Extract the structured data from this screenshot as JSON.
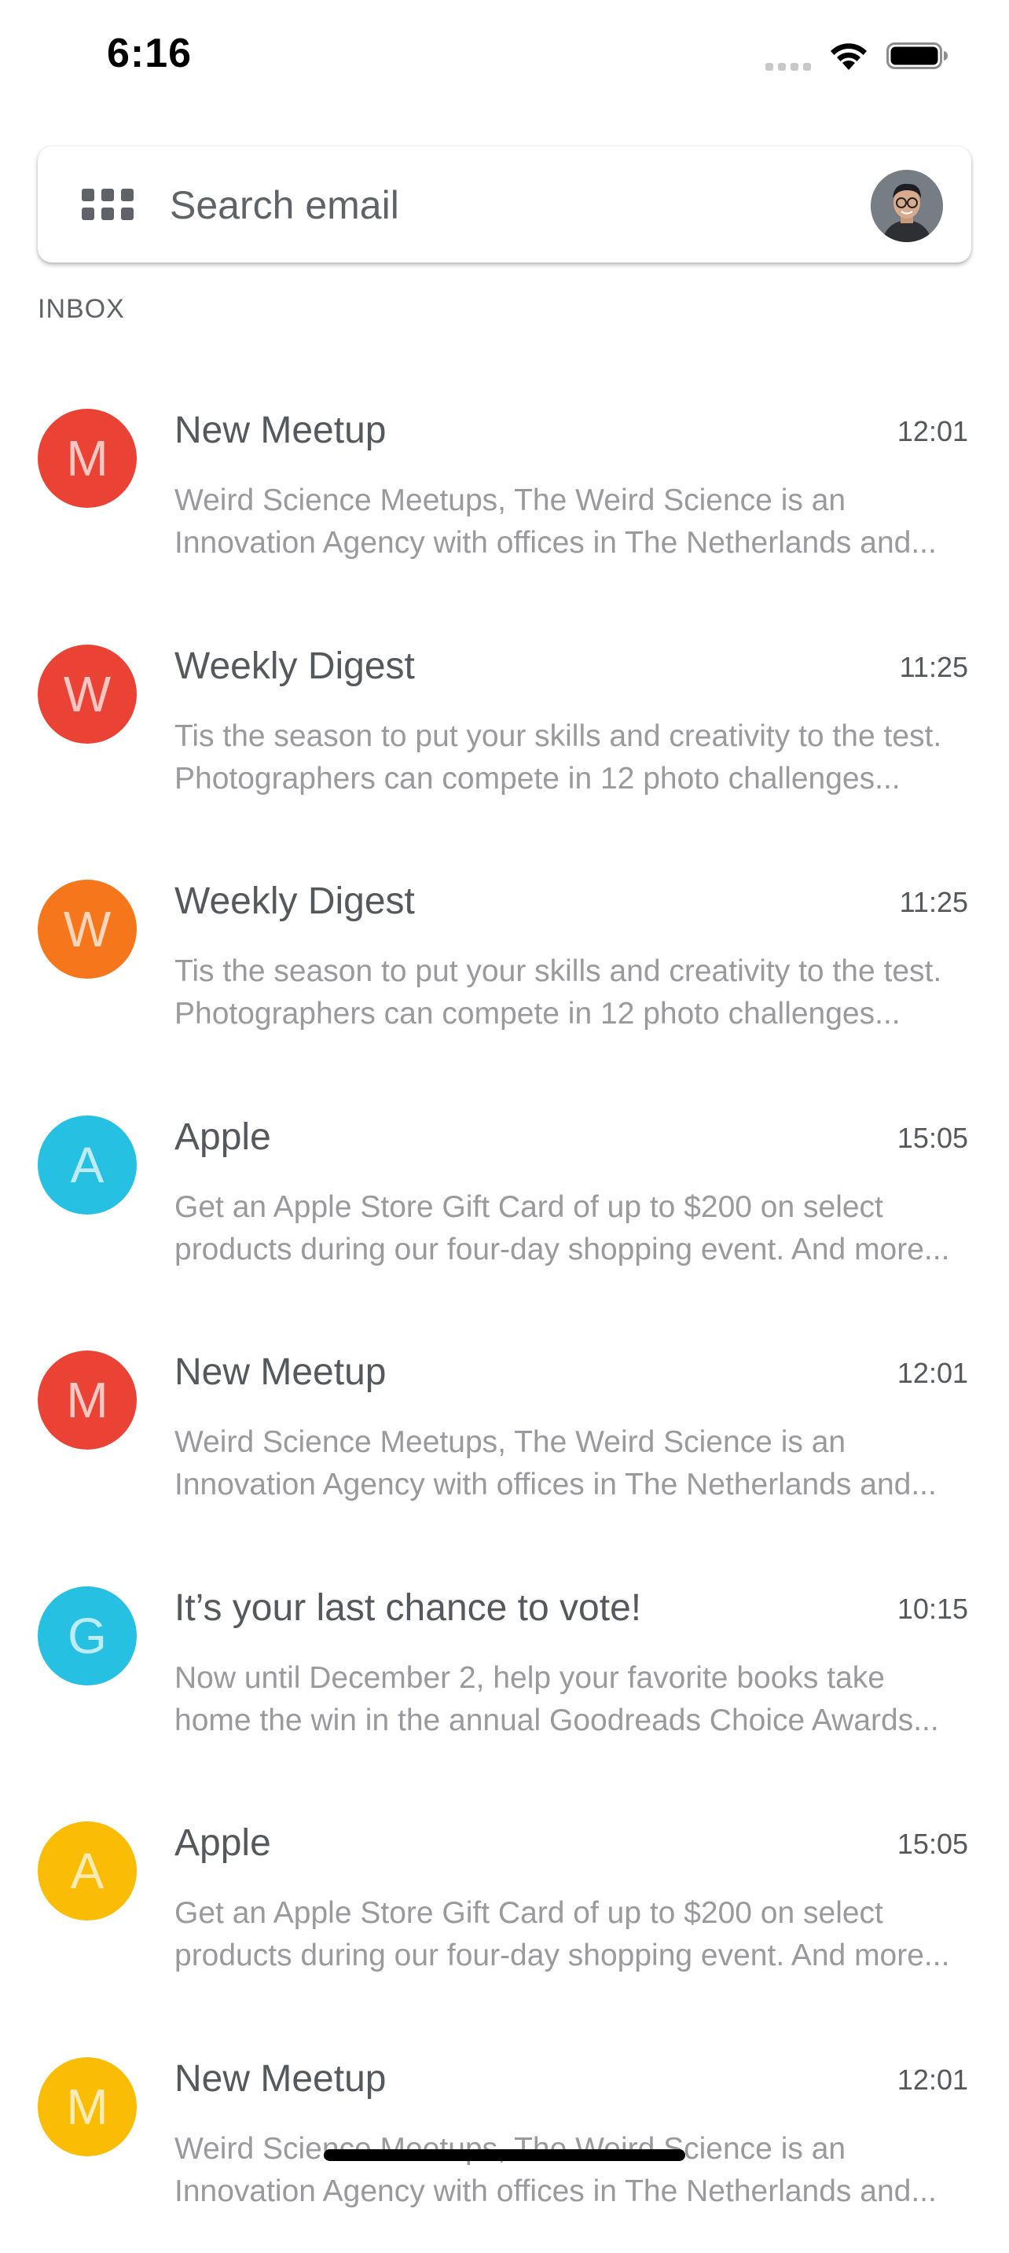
{
  "status_bar": {
    "time": "6:16"
  },
  "search": {
    "placeholder": "Search email"
  },
  "section_label": "INBOX",
  "emails": [
    {
      "letter": "M",
      "color": "#EA4335",
      "subject": "New Meetup",
      "time": "12:01",
      "preview": "Weird Science Meetups, The Weird Science is an Innovation Agency with offices in The Netherlands and..."
    },
    {
      "letter": "W",
      "color": "#EA4335",
      "subject": "Weekly Digest",
      "time": "11:25",
      "preview": "Tis the season to put your skills and creativity to the test. Photographers can compete in 12 photo challenges..."
    },
    {
      "letter": "W",
      "color": "#F6771B",
      "subject": "Weekly Digest",
      "time": "11:25",
      "preview": "Tis the season to put your skills and creativity to the test. Photographers can compete in 12 photo challenges..."
    },
    {
      "letter": "A",
      "color": "#26C0E2",
      "subject": "Apple",
      "time": "15:05",
      "preview": "Get an Apple Store Gift Card of up to $200 on select products during our four-day shopping event. And more..."
    },
    {
      "letter": "M",
      "color": "#EA4335",
      "subject": "New Meetup",
      "time": "12:01",
      "preview": "Weird Science Meetups, The Weird Science is an Innovation Agency with offices in The Netherlands and..."
    },
    {
      "letter": "G",
      "color": "#26C0E2",
      "subject": "It’s your last chance to vote!",
      "time": "10:15",
      "preview": "Now until December 2, help your favorite books take home the win in the annual Goodreads Choice Awards..."
    },
    {
      "letter": "A",
      "color": "#FBBC05",
      "subject": "Apple",
      "time": "15:05",
      "preview": "Get an Apple Store Gift Card of up to $200 on select products during our four-day shopping event. And more..."
    },
    {
      "letter": "M",
      "color": "#FBBC05",
      "subject": "New Meetup",
      "time": "12:01",
      "preview": "Weird Science Meetups, The Weird Science is an Innovation Agency with offices in The Netherlands and..."
    }
  ]
}
